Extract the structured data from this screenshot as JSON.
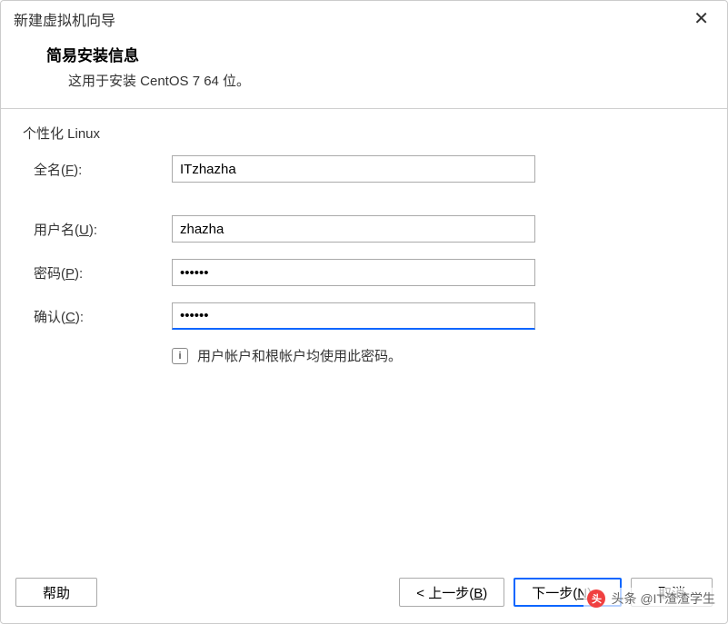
{
  "window": {
    "title": "新建虚拟机向导"
  },
  "header": {
    "title": "简易安装信息",
    "subtitle": "这用于安装 CentOS 7 64 位。"
  },
  "section": {
    "personalize": "个性化 Linux"
  },
  "form": {
    "fullname": {
      "label_prefix": "全名(",
      "mnemonic": "F",
      "label_suffix": "):",
      "value": "ITzhazha"
    },
    "username": {
      "label_prefix": "用户名(",
      "mnemonic": "U",
      "label_suffix": "):",
      "value": "zhazha"
    },
    "password": {
      "label_prefix": "密码(",
      "mnemonic": "P",
      "label_suffix": "):",
      "value": "••••••"
    },
    "confirm": {
      "label_prefix": "确认(",
      "mnemonic": "C",
      "label_suffix": "):",
      "value": "••••••"
    }
  },
  "info": {
    "icon_glyph": "i",
    "text": "用户帐户和根帐户均使用此密码。"
  },
  "buttons": {
    "help": "帮助",
    "back_prefix": "< 上一步(",
    "back_mnemonic": "B",
    "back_suffix": ")",
    "next_prefix": "下一步(",
    "next_mnemonic": "N",
    "next_suffix": ") >",
    "cancel": "取消"
  },
  "watermark": {
    "text": "头条 @IT渣渣学生"
  }
}
